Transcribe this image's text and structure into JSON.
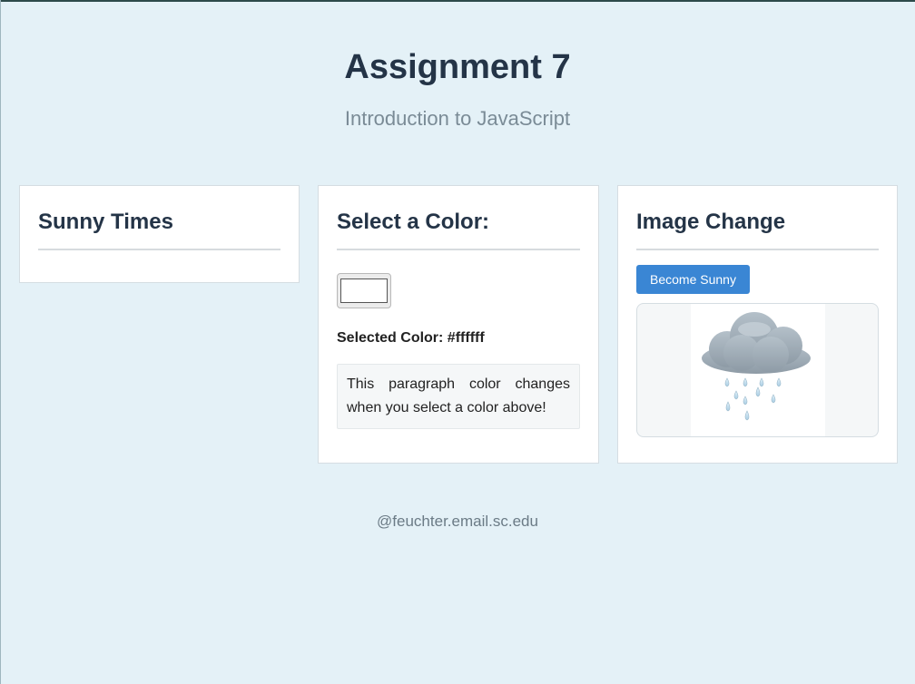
{
  "header": {
    "title": "Assignment 7",
    "subtitle": "Introduction to JavaScript"
  },
  "cards": {
    "sunny_times": {
      "title": "Sunny Times"
    },
    "select_color": {
      "title": "Select a Color:",
      "color_value": "#ffffff",
      "selected_label": "Selected Color: #ffffff",
      "paragraph": "This paragraph color changes when you select a color above!"
    },
    "image_change": {
      "title": "Image Change",
      "button_label": "Become Sunny",
      "image_icon": "rain-cloud-icon"
    }
  },
  "footer": {
    "email": "@feuchter.email.sc.edu"
  },
  "colors": {
    "background": "#e4f1f7",
    "button": "#3a86d4",
    "title": "#243447"
  }
}
